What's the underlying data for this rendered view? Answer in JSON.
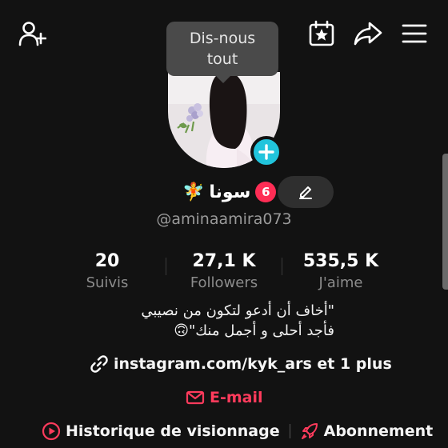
{
  "header": {
    "add_friend_icon": "person-plus-icon",
    "calendar_icon": "calendar-star-icon",
    "share_icon": "share-arrow-icon",
    "menu_icon": "hamburger-menu-icon"
  },
  "tooltip": {
    "text": "Dis-nous\ntout"
  },
  "profile": {
    "display_name": "سونا",
    "fairy_emoji": "🧚",
    "notification_count": "6",
    "username": "@aminaamira073"
  },
  "stats": [
    {
      "value": "20",
      "label": "Suivis"
    },
    {
      "value": "27,1 K",
      "label": "Followers"
    },
    {
      "value": "535,5 K",
      "label": "J'aime"
    }
  ],
  "bio": {
    "line1": "\"أخاف أن أدعو لتكون من نصيبي",
    "line2": "فأجد أحلى و أجمل منك\"🙃"
  },
  "link": {
    "text": "instagram.com/kyk_ars et 1 plus"
  },
  "email": {
    "label": "E-mail"
  },
  "bottom": {
    "history_label": "Historique de visionnage",
    "subscription_label": "Abonnement"
  },
  "colors": {
    "background": "#121212",
    "accent_cyan": "#21c4dc",
    "accent_red": "#ff3b5c",
    "badge_red": "#ff2d55"
  }
}
